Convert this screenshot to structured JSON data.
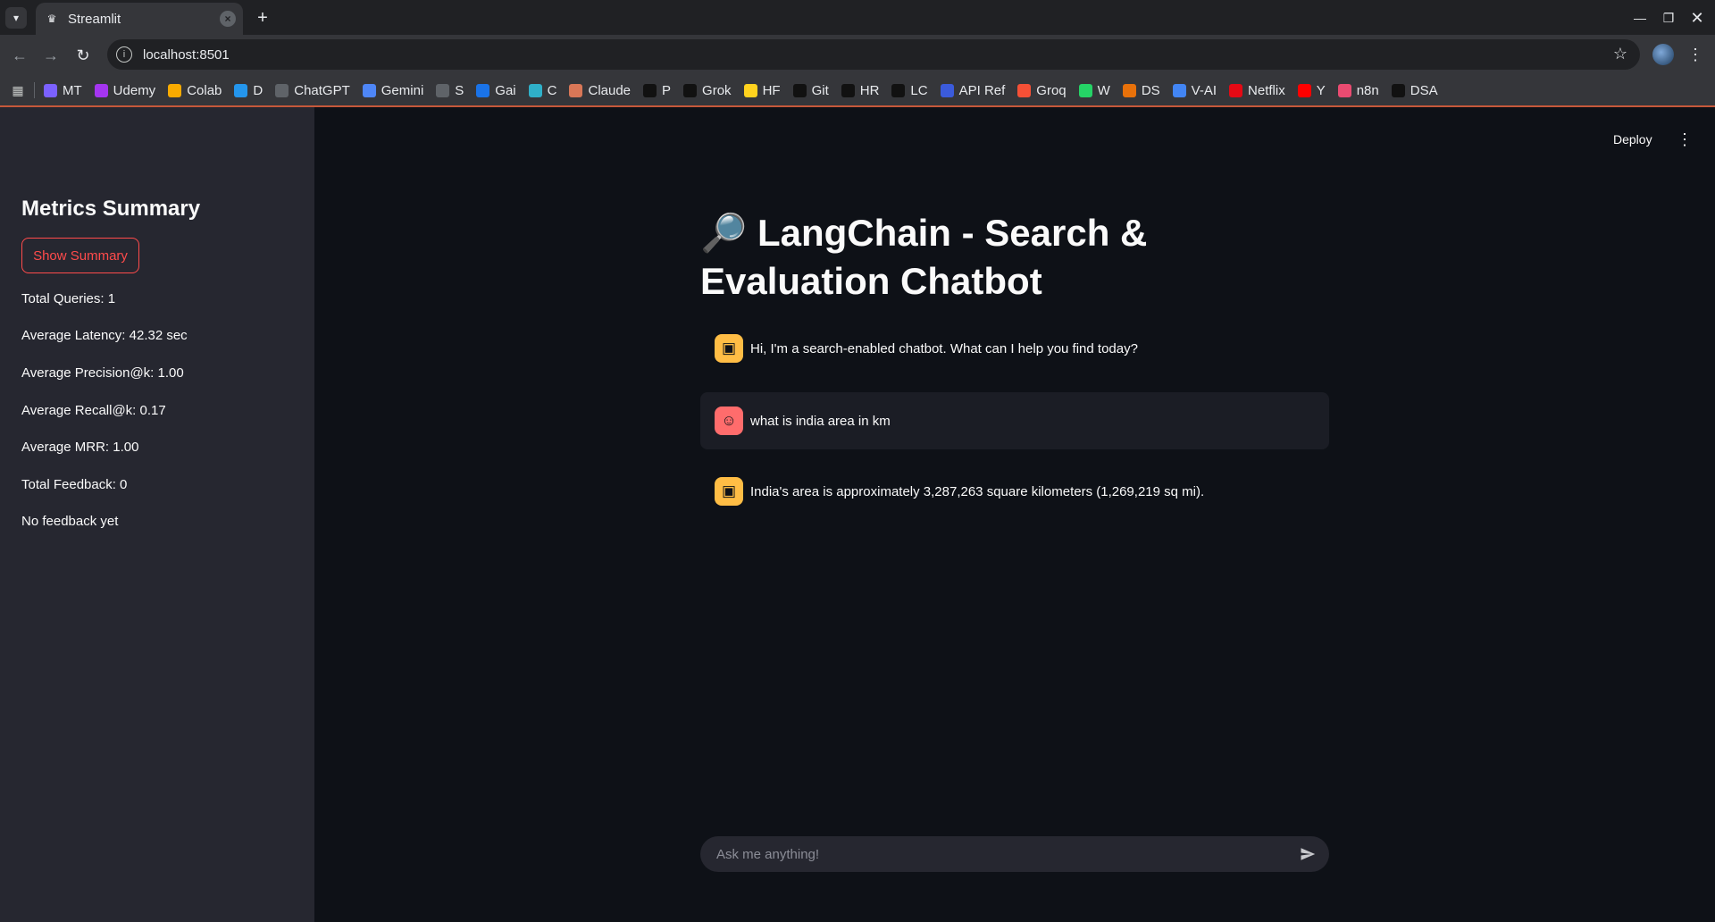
{
  "browser": {
    "tab_title": "Streamlit",
    "url": "localhost:8501",
    "bookmarks": [
      {
        "label": "MT",
        "icon": "mt-icon",
        "color": "#7b61ff"
      },
      {
        "label": "Udemy",
        "icon": "udemy-icon",
        "color": "#a435f0"
      },
      {
        "label": "Colab",
        "icon": "colab-icon",
        "color": "#f9ab00"
      },
      {
        "label": "D",
        "icon": "docker-icon",
        "color": "#2496ed"
      },
      {
        "label": "ChatGPT",
        "icon": "chatgpt-icon",
        "color": "#5f6368"
      },
      {
        "label": "Gemini",
        "icon": "gemini-icon",
        "color": "#4e86f7"
      },
      {
        "label": "S",
        "icon": "s-icon",
        "color": "#5f6368"
      },
      {
        "label": "Gai",
        "icon": "gai-icon",
        "color": "#1a73e8"
      },
      {
        "label": "C",
        "icon": "copilot-icon",
        "color": "#2fb0c9"
      },
      {
        "label": "Claude",
        "icon": "claude-icon",
        "color": "#d97757"
      },
      {
        "label": "P",
        "icon": "perplexity-icon",
        "color": "#111111"
      },
      {
        "label": "Grok",
        "icon": "grok-icon",
        "color": "#111111"
      },
      {
        "label": "HF",
        "icon": "huggingface-icon",
        "color": "#ffd21e"
      },
      {
        "label": "Git",
        "icon": "github-icon",
        "color": "#111111"
      },
      {
        "label": "HR",
        "icon": "hackerrank-icon",
        "color": "#111111"
      },
      {
        "label": "LC",
        "icon": "leetcode-icon",
        "color": "#111111"
      },
      {
        "label": "API Ref",
        "icon": "api-ref-icon",
        "color": "#3b5bdb"
      },
      {
        "label": "Groq",
        "icon": "groq-icon",
        "color": "#f55036"
      },
      {
        "label": "W",
        "icon": "whatsapp-icon",
        "color": "#25d366"
      },
      {
        "label": "DS",
        "icon": "ds-icon",
        "color": "#e8710a"
      },
      {
        "label": "V-AI",
        "icon": "vertex-ai-icon",
        "color": "#4285f4"
      },
      {
        "label": "Netflix",
        "icon": "netflix-icon",
        "color": "#e50914"
      },
      {
        "label": "Y",
        "icon": "youtube-icon",
        "color": "#ff0000"
      },
      {
        "label": "n8n",
        "icon": "n8n-icon",
        "color": "#ea4b71"
      },
      {
        "label": "DSA",
        "icon": "dsa-icon",
        "color": "#111111"
      }
    ]
  },
  "sidebar": {
    "title": "Metrics Summary",
    "button_label": "Show Summary",
    "metrics": [
      "Total Queries: 1",
      "Average Latency: 42.32 sec",
      "Average Precision@k: 1.00",
      "Average Recall@k: 0.17",
      "Average MRR: 1.00",
      "Total Feedback: 0",
      "No feedback yet"
    ]
  },
  "header": {
    "deploy_label": "Deploy"
  },
  "main": {
    "title_icon": "🔎",
    "title": "LangChain - Search & Evaluation Chatbot",
    "messages": [
      {
        "role": "assistant",
        "text": "Hi, I'm a search-enabled chatbot. What can I help you find today?"
      },
      {
        "role": "user",
        "text": "what is india area in km"
      },
      {
        "role": "assistant",
        "text": "India's area is approximately 3,287,263 square kilometers (1,269,219 sq mi)."
      }
    ],
    "chat_placeholder": "Ask me anything!"
  },
  "colors": {
    "accent": "#ff4b4b",
    "bot_avatar": "#ffbd45",
    "user_avatar": "#ff6c6c",
    "sidebar_bg": "#262730",
    "main_bg": "#0e1117"
  }
}
